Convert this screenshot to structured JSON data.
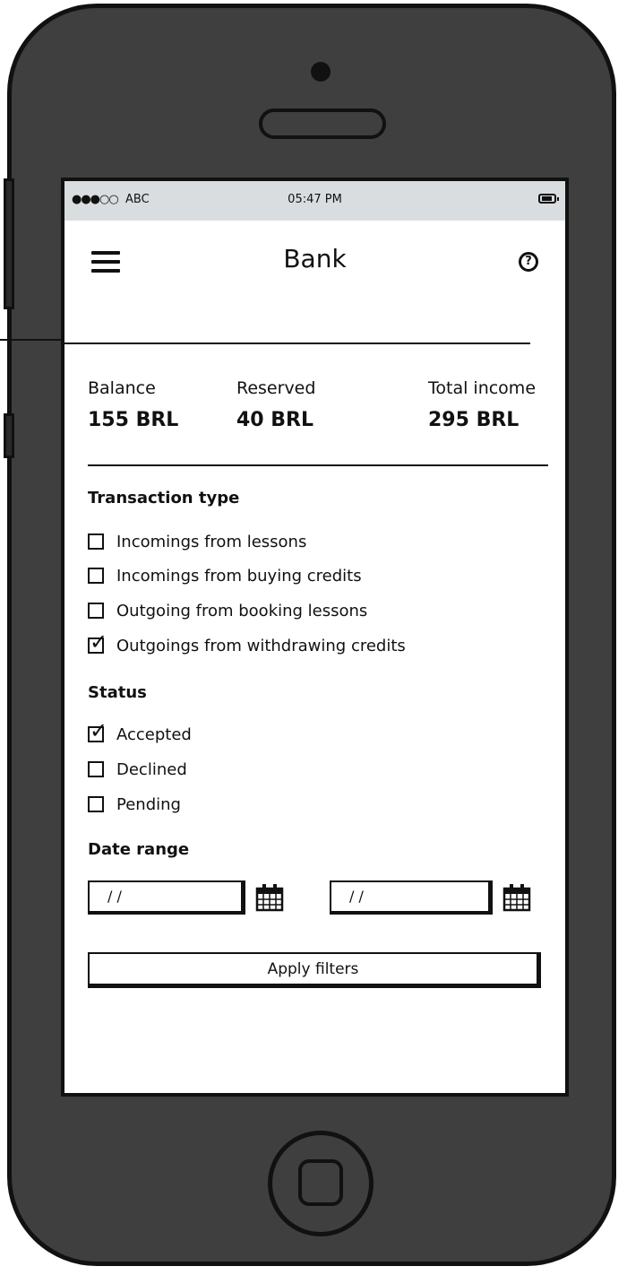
{
  "status_bar": {
    "signal": "●●●○○",
    "carrier": "ABC",
    "time": "05:47 PM"
  },
  "header": {
    "title": "Bank",
    "help_icon": "question-circle-icon",
    "menu_icon": "hamburger-menu-icon"
  },
  "summary": [
    {
      "label": "Balance",
      "value": "155 BRL"
    },
    {
      "label": "Reserved",
      "value": "40 BRL"
    },
    {
      "label": "Total income",
      "value": "295 BRL"
    }
  ],
  "transaction_type": {
    "title": "Transaction type",
    "options": [
      {
        "label": "Incomings from lessons",
        "checked": false
      },
      {
        "label": "Incomings from buying credits",
        "checked": false
      },
      {
        "label": "Outgoing from booking lessons",
        "checked": false
      },
      {
        "label": "Outgoings from withdrawing credits",
        "checked": true
      }
    ]
  },
  "status": {
    "title": "Status",
    "options": [
      {
        "label": "Accepted",
        "checked": true
      },
      {
        "label": "Declined",
        "checked": false
      },
      {
        "label": "Pending",
        "checked": false
      }
    ]
  },
  "date_range": {
    "title": "Date range",
    "from_value": "/ /",
    "to_value": "/ /"
  },
  "apply_label": "Apply filters"
}
